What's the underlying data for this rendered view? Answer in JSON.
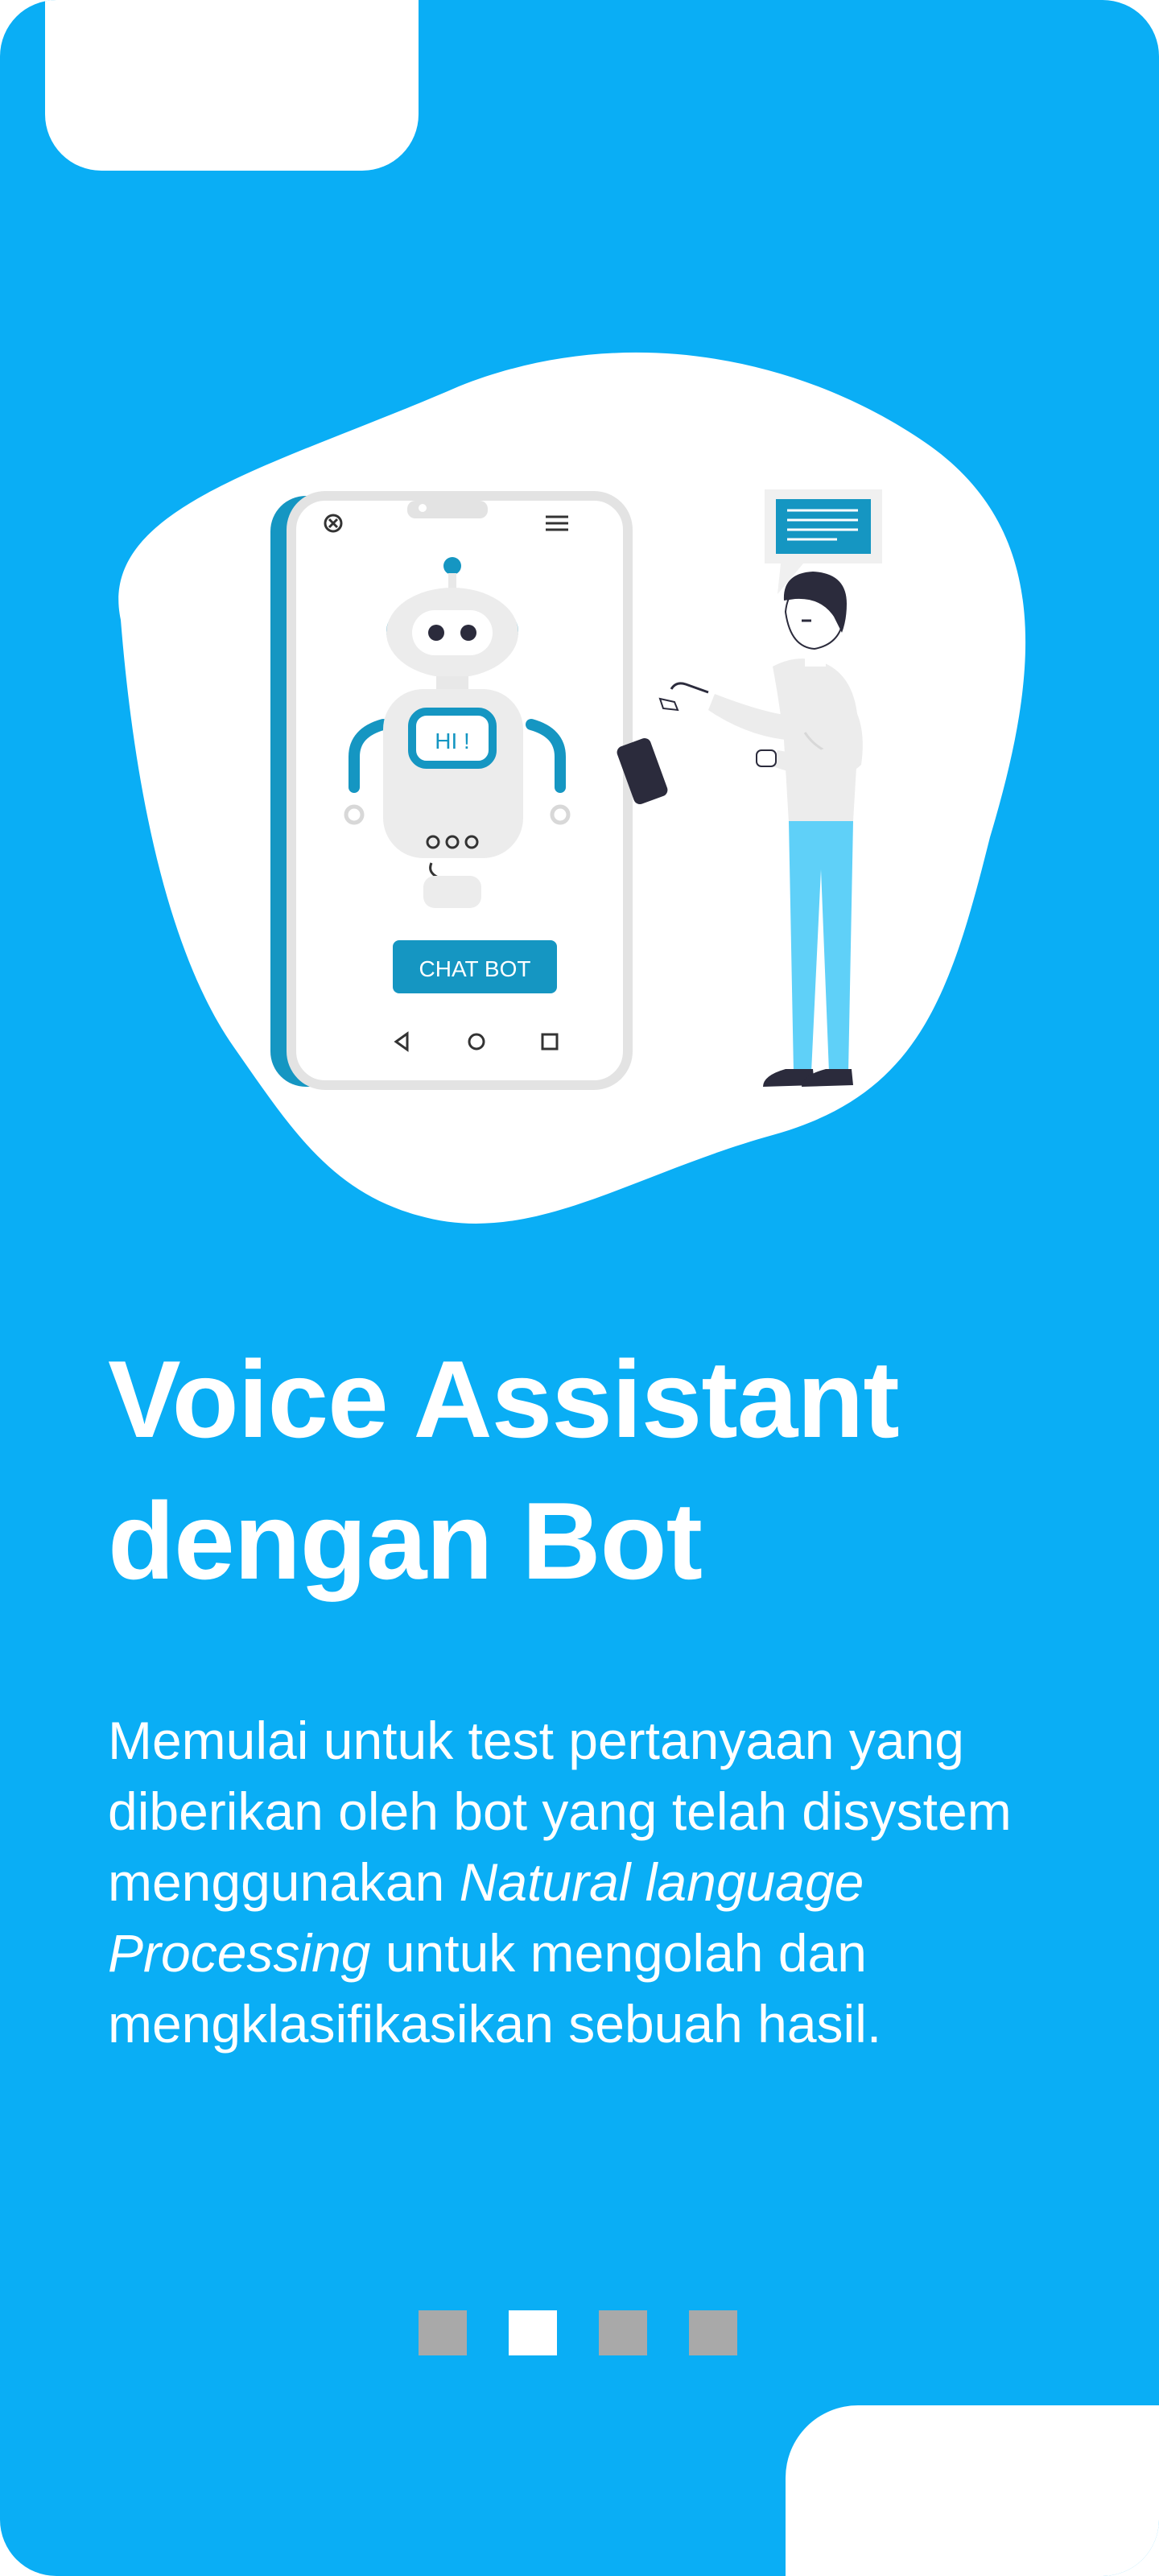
{
  "onboarding": {
    "title_line1": "Voice Assistant",
    "title_line2": "dengan Bot",
    "description": {
      "part1": "Memulai untuk test pertanyaan yang diberikan oleh bot yang telah disystem menggunakan ",
      "emphasis": "Natural language Processing",
      "part2": " untuk mengolah dan mengklasifikasikan sebuah hasil."
    },
    "pagination": {
      "total": 4,
      "active_index": 1
    }
  },
  "illustration": {
    "robot_greeting": "HI !",
    "chat_button_label": "CHAT BOT"
  },
  "colors": {
    "background": "#0aaef5",
    "accent_teal": "#1596c2",
    "pants": "#5fd0f8",
    "dot_inactive": "#a9a9a9",
    "dot_active": "#ffffff"
  }
}
